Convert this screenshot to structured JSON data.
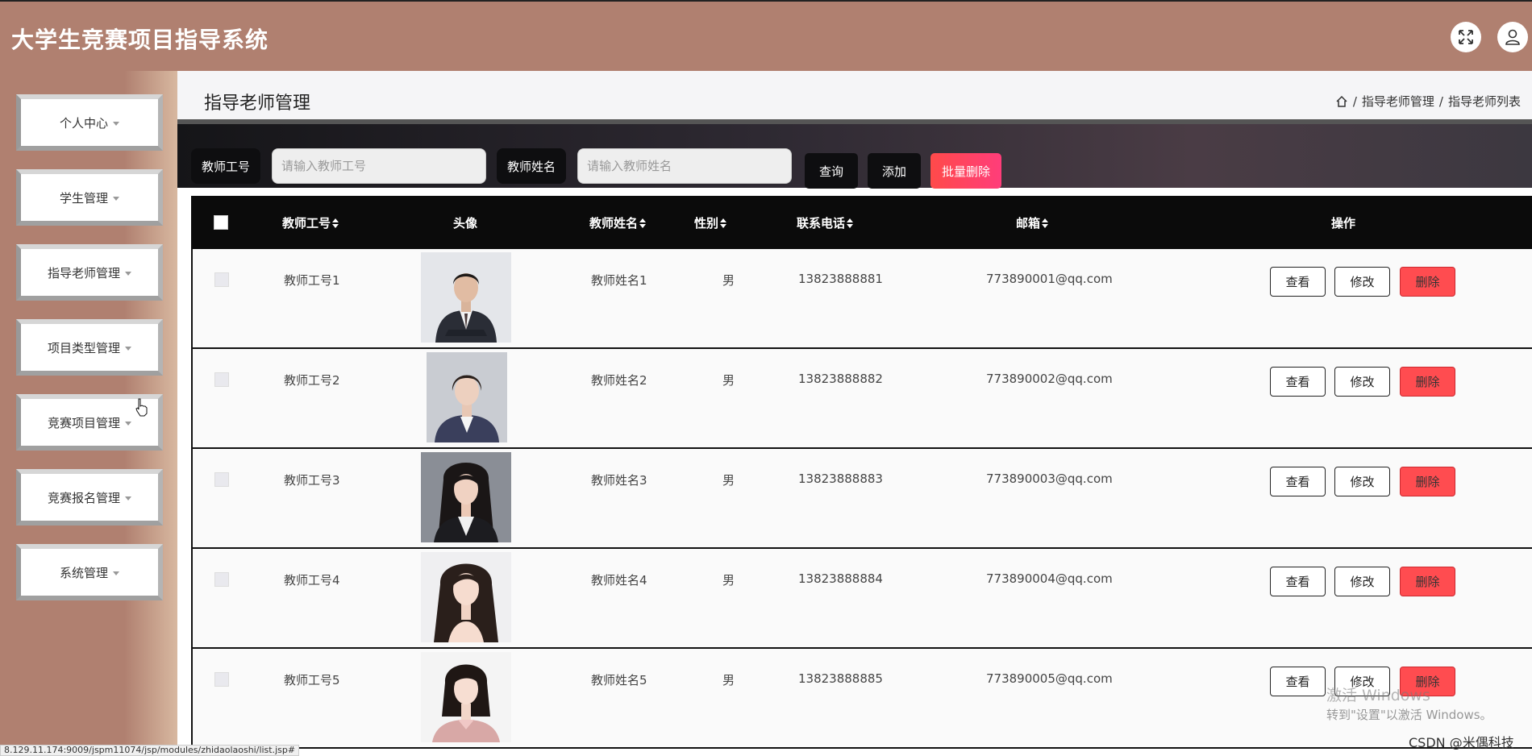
{
  "header": {
    "app_title": "大学生竞赛项目指导系统",
    "fullscreen_icon": "expand-icon",
    "user_icon": "user-icon"
  },
  "sidebar": {
    "items": [
      {
        "label": "个人中心"
      },
      {
        "label": "学生管理"
      },
      {
        "label": "指导老师管理"
      },
      {
        "label": "项目类型管理"
      },
      {
        "label": "竞赛项目管理"
      },
      {
        "label": "竞赛报名管理"
      },
      {
        "label": "系统管理"
      }
    ]
  },
  "page": {
    "title": "指导老师管理",
    "breadcrumb": [
      "指导老师管理",
      "指导老师列表"
    ],
    "breadcrumb_sep": "/"
  },
  "search": {
    "teacher_no_label": "教师工号",
    "teacher_no_placeholder": "请输入教师工号",
    "teacher_name_label": "教师姓名",
    "teacher_name_placeholder": "请输入教师姓名",
    "query_button": "查询",
    "add_button": "添加",
    "batch_delete_button": "批量删除"
  },
  "table": {
    "headers": {
      "teacher_no": "教师工号",
      "avatar": "头像",
      "teacher_name": "教师姓名",
      "gender": "性别",
      "phone": "联系电话",
      "email": "邮箱",
      "actions": "操作"
    },
    "action_labels": {
      "view": "查看",
      "edit": "修改",
      "delete": "删除"
    },
    "rows": [
      {
        "teacher_no": "教师工号1",
        "teacher_name": "教师姓名1",
        "gender": "男",
        "phone": "13823888881",
        "email": "773890001@qq.com"
      },
      {
        "teacher_no": "教师工号2",
        "teacher_name": "教师姓名2",
        "gender": "男",
        "phone": "13823888882",
        "email": "773890002@qq.com"
      },
      {
        "teacher_no": "教师工号3",
        "teacher_name": "教师姓名3",
        "gender": "男",
        "phone": "13823888883",
        "email": "773890003@qq.com"
      },
      {
        "teacher_no": "教师工号4",
        "teacher_name": "教师姓名4",
        "gender": "男",
        "phone": "13823888884",
        "email": "773890004@qq.com"
      },
      {
        "teacher_no": "教师工号5",
        "teacher_name": "教师姓名5",
        "gender": "男",
        "phone": "13823888885",
        "email": "773890005@qq.com"
      }
    ]
  },
  "overlay": {
    "status_url": "8.129.11.174:9009/jspm11074/jsp/modules/zhidaolaoshi/list.jsp#",
    "activate_windows": "激活 Windows",
    "activate_hint": "转到\"设置\"以激活 Windows。",
    "csdn_mark": "CSDN @米偶科技"
  },
  "colors": {
    "brand": "#b08070",
    "header_bg": "#0b0b0b",
    "danger": "#ff4c50"
  }
}
